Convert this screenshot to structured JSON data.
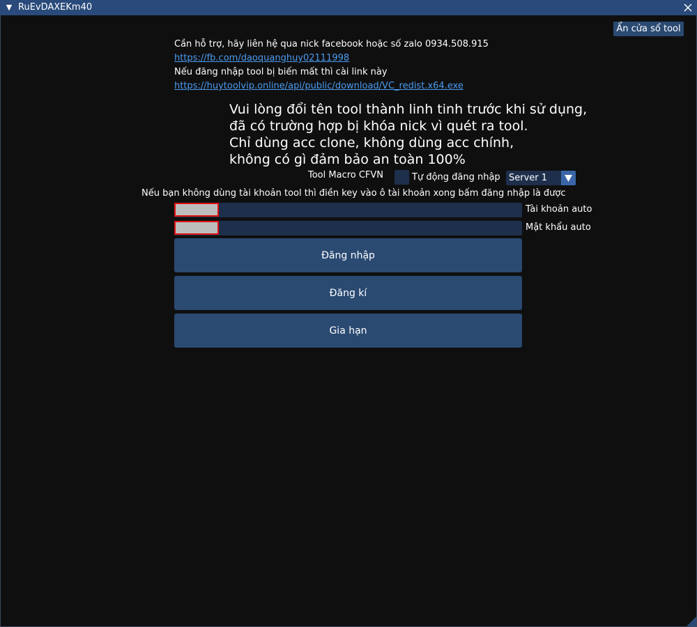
{
  "window": {
    "title": "RuEvDAXEKm40",
    "collapse_glyph": "▼",
    "close_glyph": "✕"
  },
  "hide_button": "Ẩn cửa sổ tool",
  "support": {
    "line1": "Cần hỗ trợ, hãy liên hệ qua nick facebook hoặc số zalo 0934.508.915",
    "facebook_link": "https://fb.com/daoquanghuy02111998",
    "line2": "Nếu đăng nhập tool bị biến mất thì cài link này",
    "redist_link": "https://huytoolvip.online/api/public/download/VC_redist.x64.exe"
  },
  "warning": {
    "line1": "Vui lòng đổi tên tool thành linh tinh trước khi sử dụng,",
    "line2": "đã có trường hợp bị khóa nick vì quét ra tool.",
    "line3": "Chỉ dùng acc clone, không dùng acc chính,",
    "line4": "không có gì đảm bảo an toàn 100%"
  },
  "tool_name": "Tool Macro CFVN",
  "auto_login": {
    "label": "Tự động đăng nhập",
    "checked": false
  },
  "server_select": {
    "value": "Server 1",
    "arrow_glyph": "▼"
  },
  "key_hint": "Nếu bạn không dùng tài khoản tool thì điền key vào ô tài khoản xong bấm đăng nhập là được",
  "account_field": {
    "label": "Tài khoản auto",
    "value": ""
  },
  "password_field": {
    "label": "Mật khẩu auto",
    "value": ""
  },
  "buttons": {
    "login": "Đăng nhập",
    "register": "Đăng kí",
    "extend": "Gia hạn"
  },
  "colors": {
    "titlebar": "#294a7a",
    "frame_bg": "#0f0f0f",
    "button": "#2a4a72",
    "input": "#1e2f4c",
    "link": "#4b9bf0",
    "mask_border": "#e01010"
  }
}
